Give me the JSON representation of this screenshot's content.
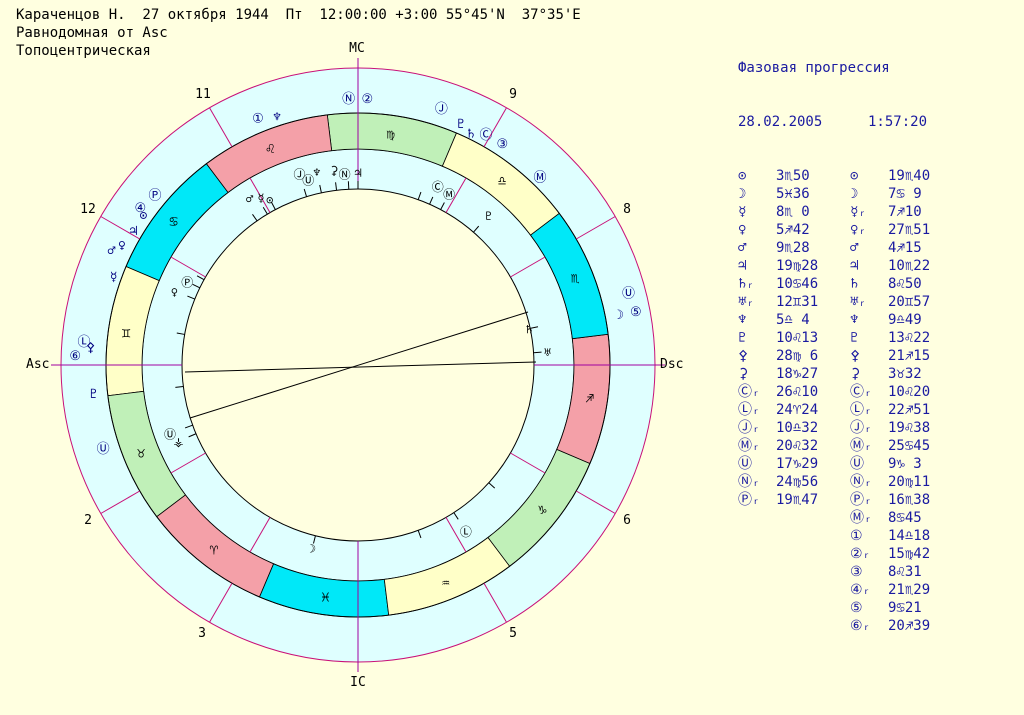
{
  "header": {
    "line1": "Караченцов Н.  27 октября 1944  Пт  12:00:00 +3:00 55°45'N  37°35'E",
    "line2": "Равнодомная от Asc",
    "line3": "Топоцентрическая"
  },
  "colors": {
    "background": "#ffffe0",
    "outer_ring": "#dfffff",
    "zodiac_fire": "#f4a0a8",
    "zodiac_earth": "#c0f0b8",
    "zodiac_air": "#ffffc8",
    "zodiac_water": "#00e8f8",
    "cusp_line": "#c81078",
    "axis_line": "#a000a0",
    "right_panel_text": "#1a1aa0"
  },
  "chart": {
    "axes": {
      "mc": "MC",
      "ic": "IC",
      "asc": "Asc",
      "dsc": "Dsc"
    },
    "house_numbers": {
      "h9": "9",
      "h8": "8",
      "h6": "6",
      "h5": "5",
      "h3": "3",
      "h2": "2",
      "h12": "12",
      "h11": "11"
    },
    "sign_glyphs": [
      "♍",
      "♌",
      "♋",
      "♊",
      "♉",
      "♈",
      "♓",
      "♒",
      "♑",
      "♐",
      "♏",
      "♎"
    ],
    "outer_glyphs": [
      {
        "name": "north-node-glyph",
        "t": "Ⓝ",
        "c": "#000080"
      },
      {
        "name": "point-2-glyph",
        "t": "②",
        "c": "#000080"
      },
      {
        "name": "point-1-glyph",
        "t": "①",
        "c": "#000080"
      },
      {
        "name": "neptune-glyph",
        "t": "♆",
        "c": "#000080"
      },
      {
        "name": "juno-glyph",
        "t": "Ⓙ",
        "c": "#000080"
      },
      {
        "name": "pluto-glyph",
        "t": "♇",
        "c": "#000080"
      },
      {
        "name": "chiron-glyph",
        "t": "Ⓒ",
        "c": "#000080"
      },
      {
        "name": "point-3-glyph",
        "t": "③",
        "c": "#000080"
      },
      {
        "name": "saturn-glyph",
        "t": "♄",
        "c": "#000080"
      },
      {
        "name": "mc-glyph",
        "t": "Ⓜ",
        "c": "#000080"
      },
      {
        "name": "moon-glyph",
        "t": "☽",
        "c": "#000080"
      },
      {
        "name": "uranus-glyph",
        "t": "Ⓤ",
        "c": "#000080"
      },
      {
        "name": "point-5-glyph",
        "t": "⑤",
        "c": "#000080"
      },
      {
        "name": "jupiter-glyph",
        "t": "♃",
        "c": "#000080"
      },
      {
        "name": "proserpina-glyph",
        "t": "Ⓟ",
        "c": "#000080"
      },
      {
        "name": "point-4-glyph",
        "t": "④",
        "c": "#000080"
      },
      {
        "name": "sun-glyph",
        "t": "⊙",
        "c": "#000080"
      },
      {
        "name": "venus-glyph",
        "t": "♀",
        "c": "#000080"
      },
      {
        "name": "mars-glyph",
        "t": "♂",
        "c": "#000080"
      },
      {
        "name": "mercury-glyph",
        "t": "☿",
        "c": "#000080"
      },
      {
        "name": "point-6-glyph",
        "t": "⑥",
        "c": "#000080"
      },
      {
        "name": "lilith-glyph",
        "t": "Ⓛ",
        "c": "#000080"
      },
      {
        "name": "vulcan-glyph",
        "t": "⚴",
        "c": "#000080"
      },
      {
        "name": "uranus-node-glyph",
        "t": "Ⓤ",
        "c": "#000080"
      },
      {
        "name": "pluto-glyph-2",
        "t": "♇",
        "c": "#000080"
      }
    ],
    "inner_glyphs": [
      {
        "name": "juno-inner-glyph",
        "t": "Ⓙ"
      },
      {
        "name": "neptune-inner-glyph",
        "t": "♆"
      },
      {
        "name": "ceres-inner-glyph",
        "t": "⚳"
      },
      {
        "name": "uranus-inner-glyph",
        "t": "Ⓤ"
      },
      {
        "name": "north-node-inner-glyph",
        "t": "Ⓝ"
      },
      {
        "name": "jupiter-inner-glyph",
        "t": "♃"
      },
      {
        "name": "chiron-inner-glyph",
        "t": "Ⓒ"
      },
      {
        "name": "mc-inner-glyph",
        "t": "Ⓜ"
      },
      {
        "name": "pluto-inner-glyph",
        "t": "♇"
      },
      {
        "name": "mars-inner-glyph",
        "t": "♂"
      },
      {
        "name": "mercury-inner-glyph",
        "t": "☿"
      },
      {
        "name": "sun-inner-glyph",
        "t": "⊙"
      },
      {
        "name": "proserpina-inner-glyph",
        "t": "Ⓟ"
      },
      {
        "name": "venus-inner-glyph",
        "t": "♀"
      },
      {
        "name": "saturn-inner-glyph",
        "t": "♄"
      },
      {
        "name": "uranus-dsc-inner-glyph",
        "t": "♅"
      },
      {
        "name": "uranus-low-inner-glyph",
        "t": "Ⓤ"
      },
      {
        "name": "vesta-inner-glyph",
        "t": "⚶"
      },
      {
        "name": "moon-inner-glyph",
        "t": "☽"
      },
      {
        "name": "lilith-inner-glyph",
        "t": "Ⓛ"
      }
    ]
  },
  "progression": {
    "title": "Фазовая прогрессия",
    "date": "28.02.2005",
    "time": "1:57:20",
    "rows": [
      {
        "g1": "⊙",
        "v1": "3♏50",
        "g2": "⊙",
        "v2": "19♏40"
      },
      {
        "g1": "☽",
        "v1": "5♓36",
        "g2": "☽",
        "v2": "7♋ 9"
      },
      {
        "g1": "☿",
        "v1": "8♏ 0",
        "g2": "☿ᵣ",
        "v2": "7♐10"
      },
      {
        "g1": "♀",
        "v1": "5♐42",
        "g2": "♀ᵣ",
        "v2": "27♏51"
      },
      {
        "g1": "♂",
        "v1": "9♏28",
        "g2": "♂",
        "v2": "4♐15"
      },
      {
        "g1": "♃",
        "v1": "19♍28",
        "g2": "♃",
        "v2": "10♏22"
      },
      {
        "g1": "♄ᵣ",
        "v1": "10♋46",
        "g2": "♄",
        "v2": "8♌50"
      },
      {
        "g1": "♅ᵣ",
        "v1": "12♊31",
        "g2": "♅ᵣ",
        "v2": "20♊57"
      },
      {
        "g1": "♆",
        "v1": "5♎ 4",
        "g2": "♆",
        "v2": "9♎49"
      },
      {
        "g1": "♇",
        "v1": "10♌13",
        "g2": "♇",
        "v2": "13♌22"
      },
      {
        "g1": "⚴",
        "v1": "28♍ 6",
        "g2": "⚴",
        "v2": "21♐15"
      },
      {
        "g1": "⚳",
        "v1": "18♑27",
        "g2": "⚳",
        "v2": "3♉32"
      },
      {
        "g1": "Ⓒᵣ",
        "v1": "26♌10",
        "g2": "Ⓒᵣ",
        "v2": "10♌20"
      },
      {
        "g1": "Ⓛᵣ",
        "v1": "24♈24",
        "g2": "Ⓛᵣ",
        "v2": "22♐51"
      },
      {
        "g1": "Ⓙᵣ",
        "v1": "10♎32",
        "g2": "Ⓙᵣ",
        "v2": "19♌38"
      },
      {
        "g1": "Ⓜᵣ",
        "v1": "20♌32",
        "g2": "Ⓜᵣ",
        "v2": "25♋45"
      },
      {
        "g1": "Ⓤ",
        "v1": "17♑29",
        "g2": "Ⓤ",
        "v2": "9♑ 3"
      },
      {
        "g1": "Ⓝᵣ",
        "v1": "24♍56",
        "g2": "Ⓝᵣ",
        "v2": "20♍11"
      },
      {
        "g1": "Ⓟᵣ",
        "v1": "19♏47",
        "g2": "Ⓟᵣ",
        "v2": "16♏38"
      },
      {
        "g1": "",
        "v1": "",
        "g2": "Ⓜᵣ",
        "v2": "8♋45"
      },
      {
        "g1": "",
        "v1": "",
        "g2": "①",
        "v2": "14♎18"
      },
      {
        "g1": "",
        "v1": "",
        "g2": "②ᵣ",
        "v2": "15♍42"
      },
      {
        "g1": "",
        "v1": "",
        "g2": "③",
        "v2": "8♌31"
      },
      {
        "g1": "",
        "v1": "",
        "g2": "④ᵣ",
        "v2": "21♏29"
      },
      {
        "g1": "",
        "v1": "",
        "g2": "⑤",
        "v2": "9♋21"
      },
      {
        "g1": "",
        "v1": "",
        "g2": "⑥ᵣ",
        "v2": "20♐39"
      }
    ]
  }
}
